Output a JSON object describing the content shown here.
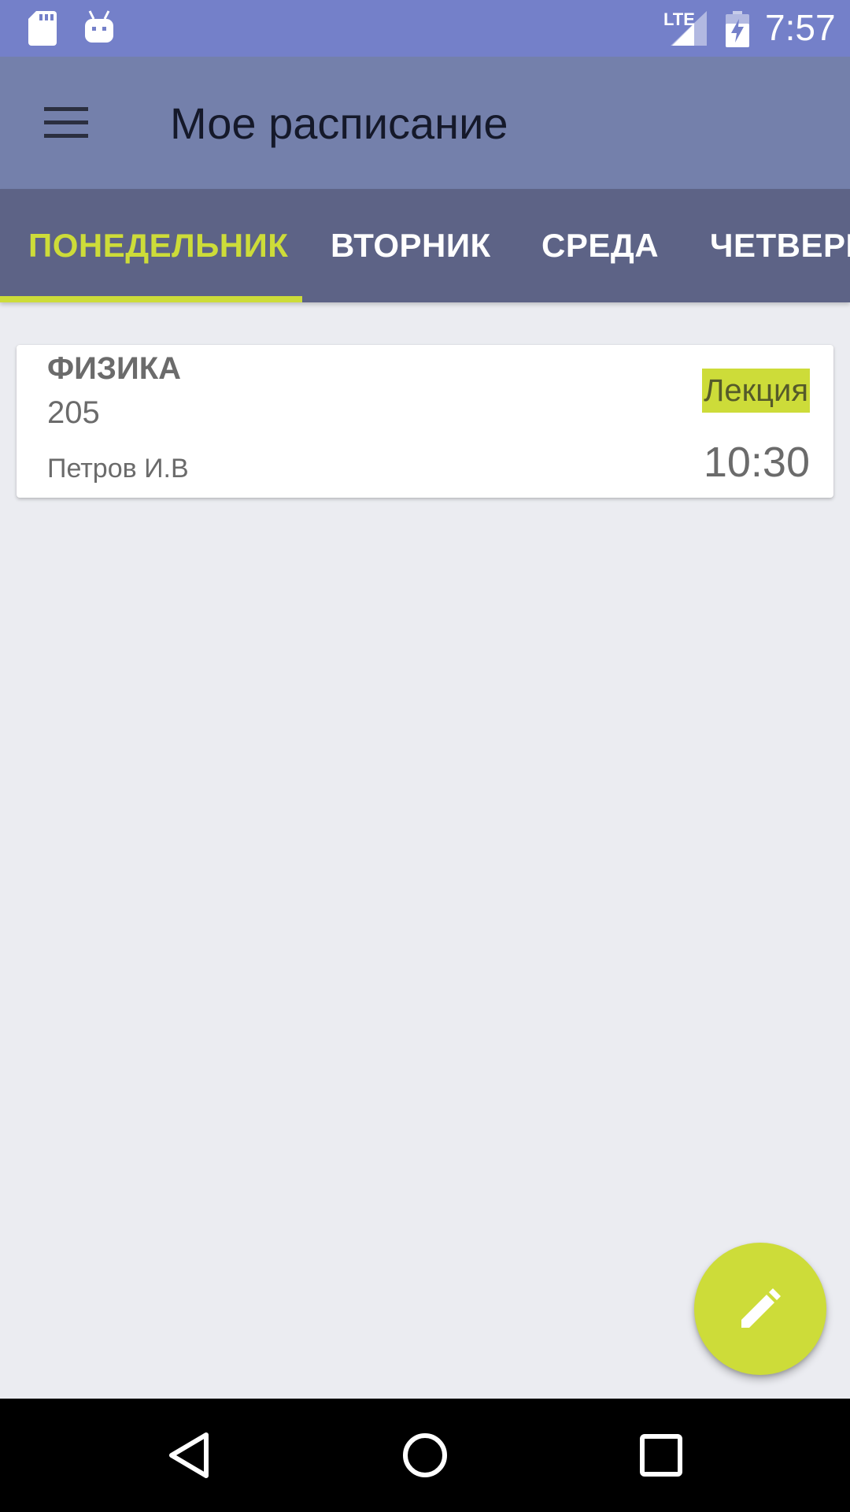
{
  "status_bar": {
    "network_label": "LTE",
    "time": "7:57",
    "icons": [
      "sd-card-icon",
      "android-debug-icon",
      "signal-icon",
      "battery-charging-icon"
    ]
  },
  "app_bar": {
    "title": "Мое расписание",
    "menu_icon": "hamburger-menu-icon"
  },
  "tabs": [
    {
      "label": "ПОНЕДЕЛЬНИК",
      "active": true
    },
    {
      "label": "ВТОРНИК",
      "active": false
    },
    {
      "label": "СРЕДА",
      "active": false
    },
    {
      "label": "ЧЕТВЕРГ",
      "active": false
    }
  ],
  "lessons": [
    {
      "subject": "ФИЗИКА",
      "room": "205",
      "teacher": "Петров И.В",
      "type": "Лекция",
      "time": "10:30"
    }
  ],
  "fab": {
    "icon": "pencil-edit-icon"
  },
  "nav_bar": {
    "icons": [
      "back-icon",
      "home-icon",
      "recents-icon"
    ]
  },
  "colors": {
    "status_bar": "#7480C9",
    "app_bar": "#7480AB",
    "tab_bar": "#5D6386",
    "accent": "#CDDC39",
    "background": "#EBECF1"
  }
}
